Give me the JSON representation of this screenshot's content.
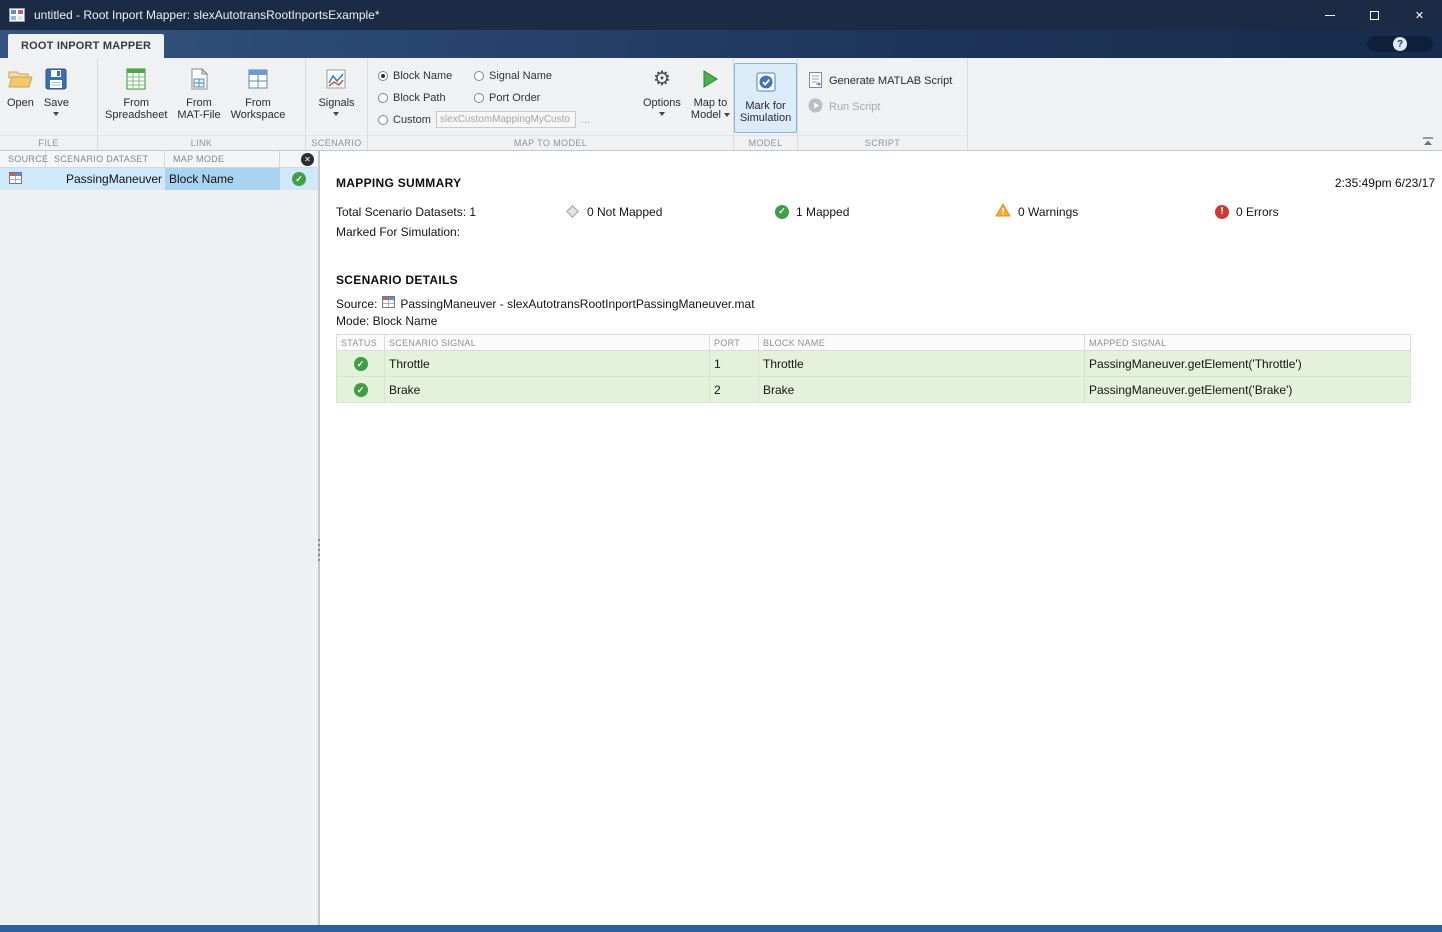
{
  "window": {
    "title": "untitled - Root Inport Mapper: slexAutotransRootInportsExample*"
  },
  "tab": {
    "label": "ROOT INPORT MAPPER"
  },
  "icons": {
    "help": "?",
    "close_window": "✕",
    "panel_close": "✕",
    "check": "✓",
    "error": "!",
    "gear": "⚙",
    "ellipsis": "..."
  },
  "ribbon": {
    "file": {
      "section": "FILE",
      "open": "Open",
      "save": "Save"
    },
    "link": {
      "section": "LINK",
      "from_spreadsheet": "From\nSpreadsheet",
      "from_mat_file": "From\nMAT-File",
      "from_workspace": "From\nWorkspace"
    },
    "scenario": {
      "section": "SCENARIO",
      "signals": "Signals"
    },
    "map": {
      "section": "MAP TO MODEL",
      "block_name": "Block Name",
      "signal_name": "Signal Name",
      "block_path": "Block Path",
      "port_order": "Port Order",
      "custom": "Custom",
      "custom_value": "slexCustomMappingMyCusto",
      "options": "Options",
      "map_line1": "Map to",
      "map_line2": "Model",
      "selected": "Block Name"
    },
    "model": {
      "section": "MODEL",
      "mark": "Mark for\nSimulation",
      "mark_active": true
    },
    "script": {
      "section": "SCRIPT",
      "generate": "Generate MATLAB Script",
      "run": "Run Script",
      "run_enabled": false
    }
  },
  "left_panel": {
    "headers": [
      "SOURCE",
      "SCENARIO DATASET",
      "MAP MODE"
    ],
    "rows": [
      {
        "dataset": "PassingManeuver",
        "map_mode": "Block Name"
      }
    ]
  },
  "summary": {
    "title": "MAPPING SUMMARY",
    "timestamp": "2:35:49pm 6/23/17",
    "total": "Total Scenario Datasets: 1",
    "marked": "Marked For Simulation:",
    "not_mapped": "0 Not Mapped",
    "mapped": "1 Mapped",
    "warnings": "0 Warnings",
    "errors": "0 Errors"
  },
  "details": {
    "title": "SCENARIO DETAILS",
    "source_label": "Source:",
    "source_value": "PassingManeuver - slexAutotransRootInportPassingManeuver.mat",
    "mode": "Mode: Block Name",
    "table": {
      "headers": [
        "STATUS",
        "SCENARIO SIGNAL",
        "PORT",
        "BLOCK NAME",
        "MAPPED SIGNAL"
      ],
      "rows": [
        {
          "signal": "Throttle",
          "port": "1",
          "block": "Throttle",
          "mapped": "PassingManeuver.getElement('Throttle')"
        },
        {
          "signal": "Brake",
          "port": "2",
          "block": "Brake",
          "mapped": "PassingManeuver.getElement('Brake')"
        }
      ]
    }
  }
}
